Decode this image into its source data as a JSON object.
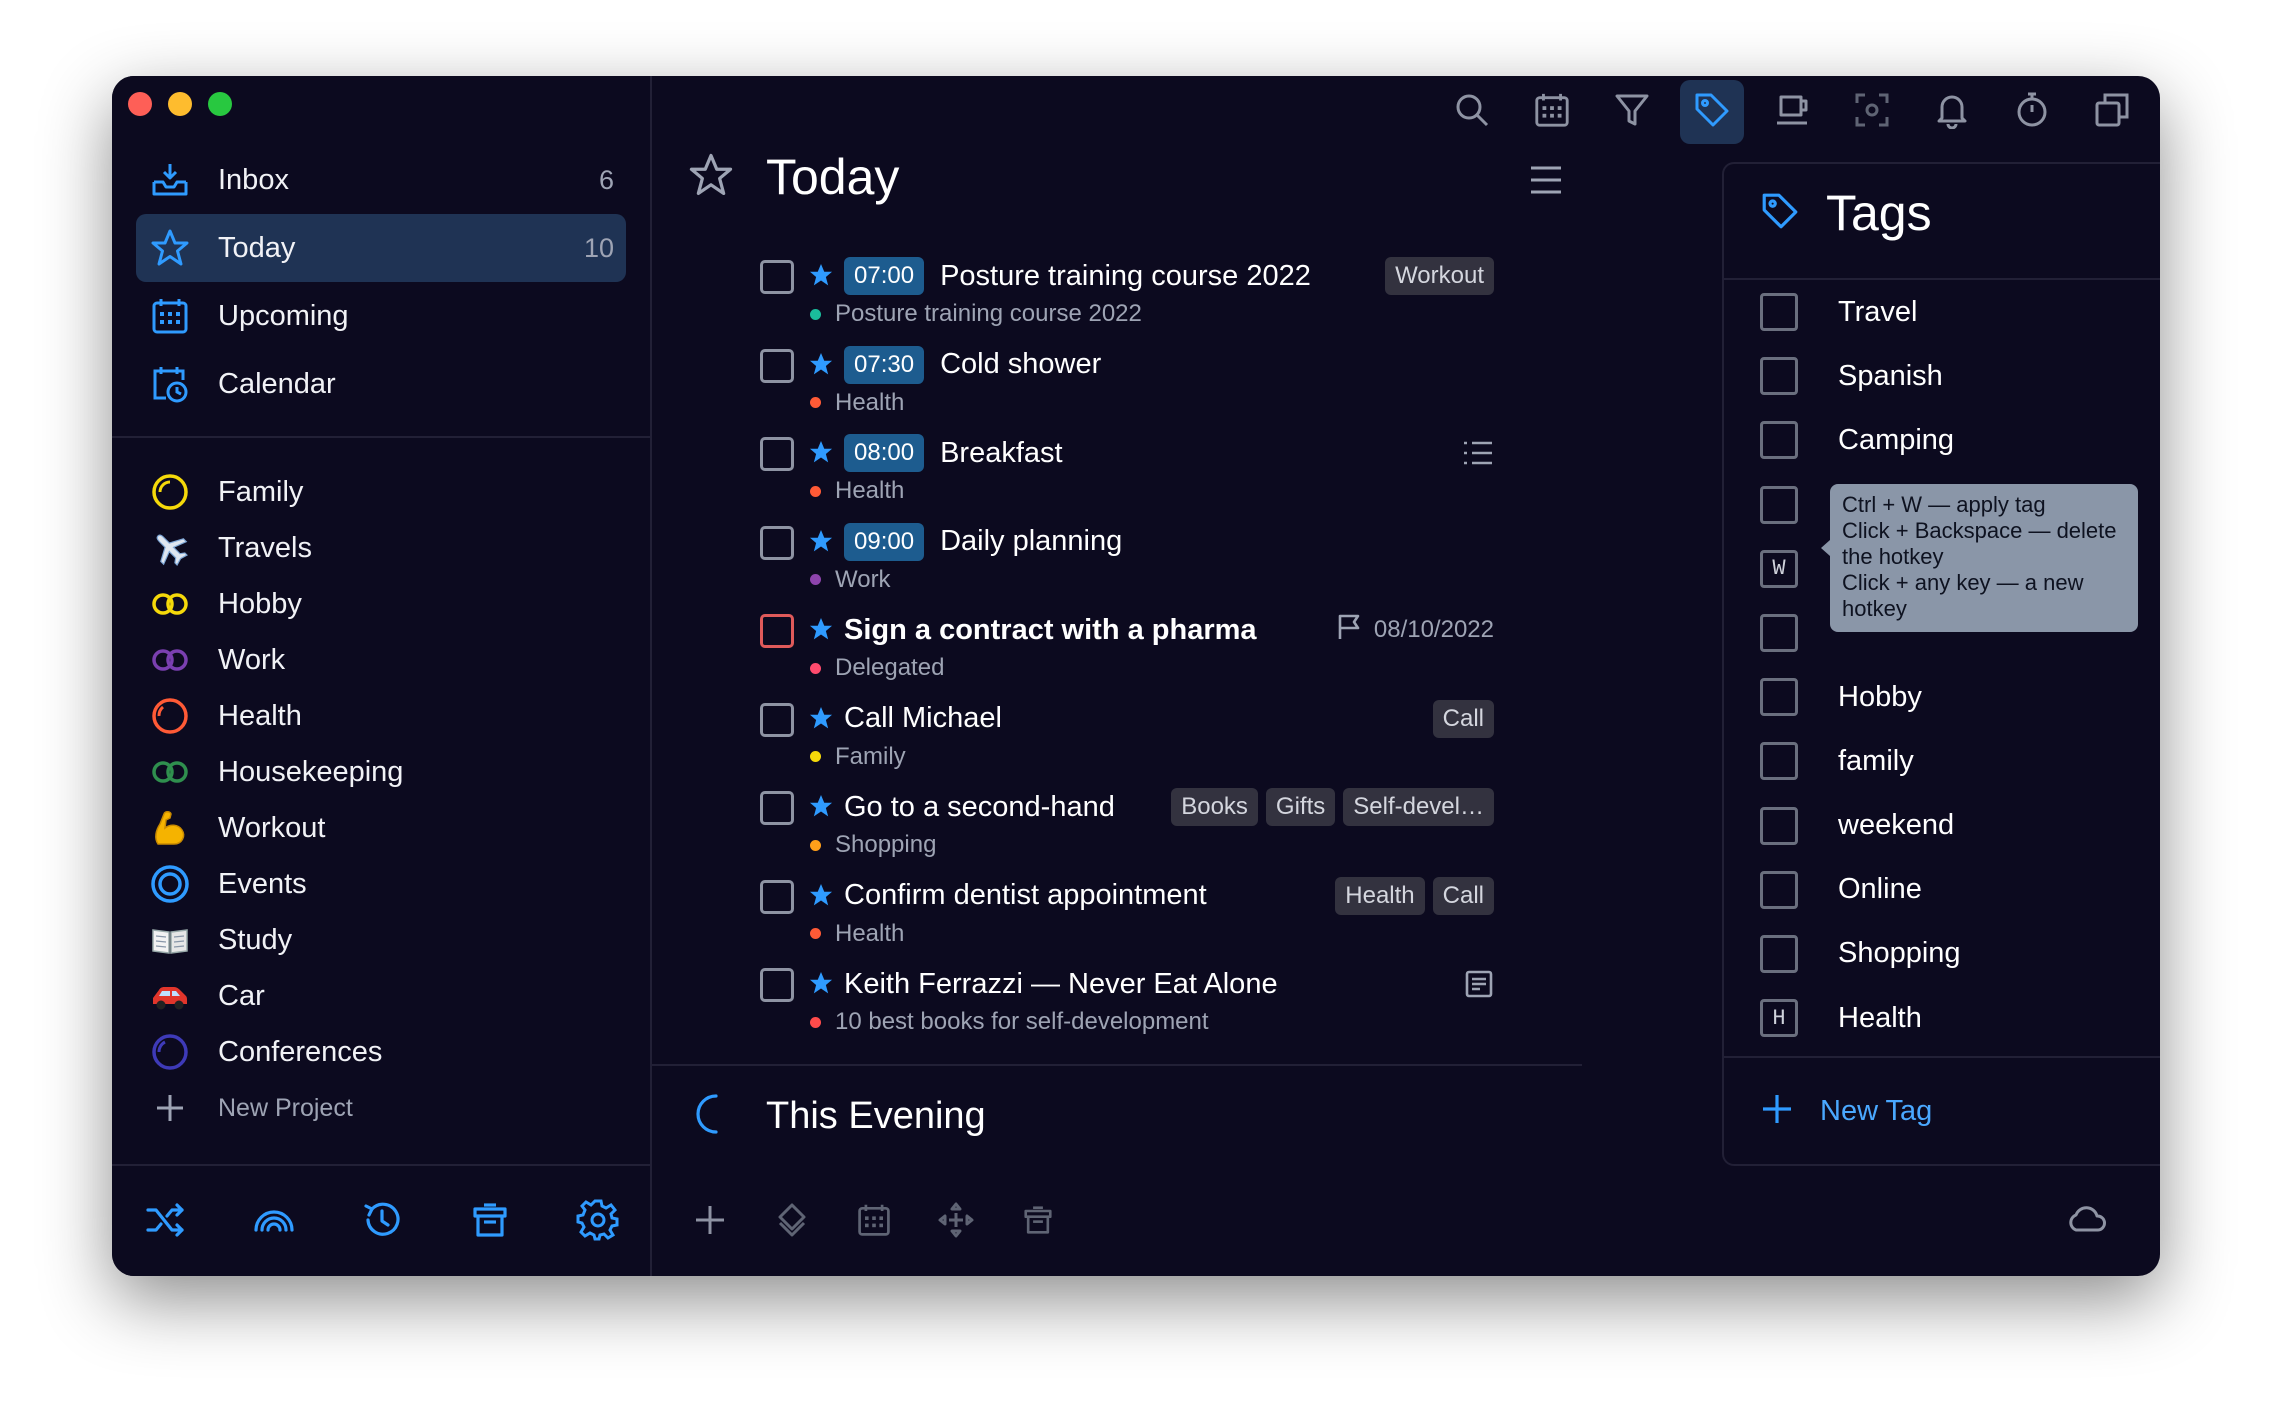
{
  "sidebar": {
    "nav": [
      {
        "label": "Inbox",
        "count": "6",
        "icon": "inbox-icon"
      },
      {
        "label": "Today",
        "count": "10",
        "icon": "star-icon",
        "active": true
      },
      {
        "label": "Upcoming",
        "count": "",
        "icon": "calendar-grid-icon"
      },
      {
        "label": "Calendar",
        "count": "",
        "icon": "calendar-clock-icon"
      }
    ],
    "projects": [
      {
        "label": "Family",
        "icon": "yellow-ring-icon"
      },
      {
        "label": "Travels",
        "icon": "airplane-icon"
      },
      {
        "label": "Hobby",
        "icon": "yellow-infinity-icon"
      },
      {
        "label": "Work",
        "icon": "purple-infinity-icon"
      },
      {
        "label": "Health",
        "icon": "orange-ring-icon"
      },
      {
        "label": "Housekeeping",
        "icon": "green-infinity-icon"
      },
      {
        "label": "Workout",
        "icon": "flexed-arm-icon"
      },
      {
        "label": "Events",
        "icon": "blue-target-icon"
      },
      {
        "label": "Study",
        "icon": "open-book-icon"
      },
      {
        "label": "Car",
        "icon": "car-icon"
      },
      {
        "label": "Conferences",
        "icon": "indigo-ring-icon"
      }
    ],
    "new_project_label": "New Project"
  },
  "main": {
    "title": "Today",
    "tasks": [
      {
        "time": "07:00",
        "title": "Posture training course 2022",
        "bold": false,
        "tags": [
          "Workout"
        ],
        "project": "Posture training course 2022",
        "dot": "#1abc9c",
        "extra": ""
      },
      {
        "time": "07:30",
        "title": "Cold shower",
        "bold": false,
        "tags": [],
        "project": "Health",
        "dot": "#ff5a36",
        "extra": ""
      },
      {
        "time": "08:00",
        "title": "Breakfast",
        "bold": false,
        "tags": [],
        "project": "Health",
        "dot": "#ff5a36",
        "extra": "list"
      },
      {
        "time": "09:00",
        "title": "Daily planning",
        "bold": false,
        "tags": [],
        "project": "Work",
        "dot": "#8e44ad",
        "extra": ""
      },
      {
        "time": "",
        "title": "Sign a contract with a pharma",
        "bold": true,
        "tags": [],
        "project": "Delegated",
        "dot": "#ff4b6e",
        "extra": "due",
        "due": "08/10/2022",
        "red": true
      },
      {
        "time": "",
        "title": "Call Michael",
        "bold": false,
        "tags": [
          "Call"
        ],
        "project": "Family",
        "dot": "#f5d90a",
        "extra": ""
      },
      {
        "time": "",
        "title": "Go to a second-hand",
        "bold": false,
        "tags": [
          "Books",
          "Gifts",
          "Self-devel…"
        ],
        "project": "Shopping",
        "dot": "#ff9f1a",
        "extra": ""
      },
      {
        "time": "",
        "title": "Confirm dentist appointment",
        "bold": false,
        "tags": [
          "Health",
          "Call"
        ],
        "project": "Health",
        "dot": "#ff5a36",
        "extra": ""
      },
      {
        "time": "",
        "title": "Keith Ferrazzi — Never Eat Alone",
        "bold": false,
        "tags": [],
        "project": "10 best books for self-development",
        "dot": "#ff4b4b",
        "extra": "note"
      }
    ],
    "evening_title": "This Evening"
  },
  "tags_panel": {
    "title": "Tags",
    "tags": [
      {
        "name": "Travel",
        "key": ""
      },
      {
        "name": "Spanish",
        "key": ""
      },
      {
        "name": "Camping",
        "key": ""
      },
      {
        "name": "",
        "key": ""
      },
      {
        "name": "",
        "key": "W"
      },
      {
        "name": "",
        "key": ""
      },
      {
        "name": "Hobby",
        "key": ""
      },
      {
        "name": "family",
        "key": ""
      },
      {
        "name": "weekend",
        "key": ""
      },
      {
        "name": "Online",
        "key": ""
      },
      {
        "name": "Shopping",
        "key": ""
      },
      {
        "name": "Health",
        "key": "H"
      }
    ],
    "new_tag_label": "New Tag",
    "tooltip": [
      "Ctrl + W — apply tag",
      "Click + Backspace — delete",
      "the hotkey",
      "Click + any key — a new",
      "hotkey"
    ]
  },
  "colors": {
    "accent": "#2f9bff",
    "active_bg": "#1f3354",
    "bg": "#0c0a1f"
  }
}
